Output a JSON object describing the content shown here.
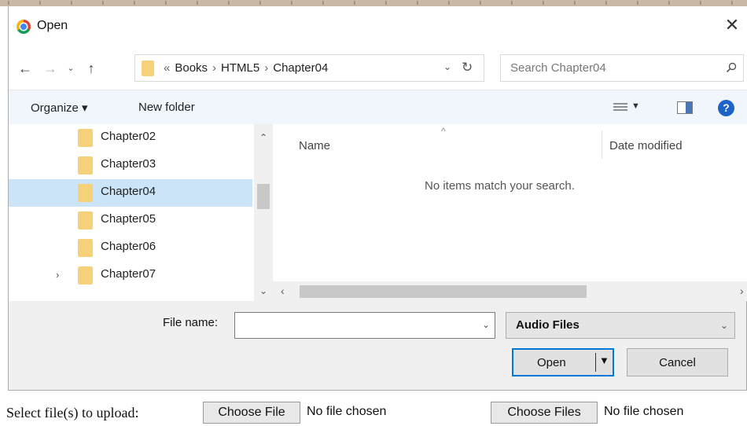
{
  "dialog": {
    "title": "Open",
    "close_glyph": "✕"
  },
  "nav": {
    "back_glyph": "←",
    "forward_glyph": "→",
    "recent_glyph": "⌄",
    "up_glyph": "↑"
  },
  "address": {
    "overflow_glyph": "«",
    "crumbs": [
      "Books",
      "HTML5",
      "Chapter04"
    ],
    "separator": "›",
    "dropdown_glyph": "⌄",
    "refresh_glyph": "↻"
  },
  "search": {
    "placeholder": "Search Chapter04"
  },
  "toolbar": {
    "organize": "Organize ▾",
    "new_folder": "New folder",
    "view_drop": "▼",
    "help": "?"
  },
  "folders": [
    {
      "label": "Chapter02",
      "selected": false,
      "expandable": false
    },
    {
      "label": "Chapter03",
      "selected": false,
      "expandable": false
    },
    {
      "label": "Chapter04",
      "selected": true,
      "expandable": false
    },
    {
      "label": "Chapter05",
      "selected": false,
      "expandable": false
    },
    {
      "label": "Chapter06",
      "selected": false,
      "expandable": false
    },
    {
      "label": "Chapter07",
      "selected": false,
      "expandable": true
    }
  ],
  "content": {
    "sort_glyph": "^",
    "col_name": "Name",
    "col_date": "Date modified",
    "empty_message": "No items match your search."
  },
  "bottom": {
    "file_name_label": "File name:",
    "file_name_value": "",
    "filter_value": "Audio Files",
    "open_label": "Open",
    "cancel_label": "Cancel"
  },
  "page": {
    "upload_label": "Select file(s) to upload:",
    "choose_file": "Choose File",
    "no_file_1": "No file chosen",
    "choose_files": "Choose Files",
    "no_file_2": "No file chosen"
  },
  "colors": {
    "selection": "#cce4f7",
    "accent": "#0078d7",
    "folder": "#f5d27a",
    "help": "#1e64c8"
  }
}
